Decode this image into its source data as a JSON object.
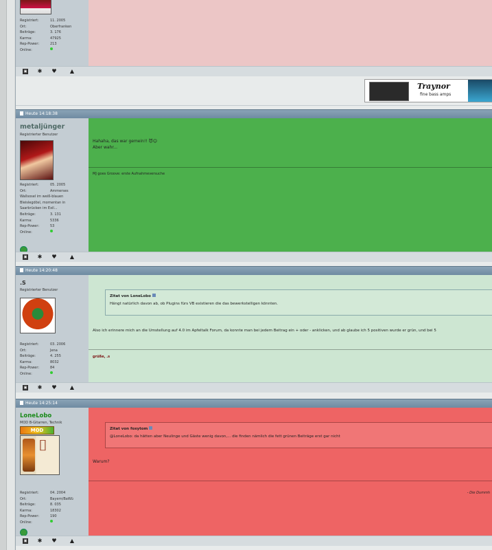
{
  "posts": [
    {
      "stats": [
        [
          "Registriert:",
          "11. 2005"
        ],
        [
          "Ort:",
          "Oberfranken"
        ],
        [
          "Beiträge:",
          "3. 176"
        ],
        [
          "Karma:",
          "47925"
        ],
        [
          "Rep-Power:",
          "213"
        ],
        [
          "Online:",
          ""
        ]
      ]
    },
    {
      "date": "Heute 14:18:38",
      "username": "metaljünger",
      "user_title": "Registrierter Benutzer",
      "stats_reg": [
        "Registriert:",
        "05. 2005"
      ],
      "stats_ort": [
        "Ort:",
        "Ammerses"
      ],
      "ort_lines": [
        "Wallsosel im weiß-blauen",
        "Bleislegdösl, momentan in",
        "Saarbrücken im Exil..."
      ],
      "stats": [
        [
          "Beiträge:",
          "3. 131"
        ],
        [
          "Karma:",
          "5336"
        ],
        [
          "Rep-Power:",
          "53"
        ],
        [
          "Online:",
          ""
        ]
      ],
      "message": [
        "Hahaha, das war gemein!! 😈😊",
        "Aber wahr..."
      ],
      "signature": "MJ goes Groove: erste Aufnahmeversuche"
    },
    {
      "date": "Heute 14:20:48",
      "username": ".S",
      "user_title": "Registrierter Benutzer",
      "stats": [
        [
          "Registriert:",
          "03. 2006"
        ],
        [
          "Ort:",
          "Jena"
        ],
        [
          "Beiträge:",
          "4. 255"
        ],
        [
          "Karma:",
          "8032"
        ],
        [
          "Rep-Power:",
          "84"
        ],
        [
          "Online:",
          ""
        ]
      ],
      "quote_from": "Zitat von LoneLobo",
      "quote_text": "Hängt natürlich davon ab, ob Plugins fürs VB existieren die das bewerkstelligen könnten.",
      "message": [
        "Also ich erinnere mich an die Umstellung auf 4.0 im Apfeltalk Forum, da konnte man bei jedem Beitrag ein + oder - anklicken, und ab glaube ich 5 positiven wurde er grün, und bei 5"
      ],
      "signature": "grüße, .s"
    },
    {
      "date": "Heute 14:25:14",
      "username": "LoneLobo",
      "user_title": "MOD B-Gitarren, Technik",
      "badge": "MOD",
      "stats": [
        [
          "Registriert:",
          "04. 2004"
        ],
        [
          "Ort:",
          "Bayern/BaWü"
        ],
        [
          "Beiträge:",
          "8. 035"
        ],
        [
          "Karma:",
          "18302"
        ],
        [
          "Rep-Power:",
          "190"
        ],
        [
          "Online:",
          ""
        ]
      ],
      "quote_from": "Zitat von foxytom",
      "quote_text": "@LoneLobo: da hätten aber Neulinge und Gäste wenig davon,... die finden nämlich die fett grünen Beiträge erst gar nicht",
      "message": [
        "Warum?"
      ],
      "signature": "- Die Dummh"
    }
  ],
  "ad": {
    "brand": "Traynor",
    "tagline": "fine bass amps"
  },
  "colors": {
    "red_post": "#ecc6c6",
    "green_post": "#4cb04c",
    "lightgreen_post": "#cde6d2",
    "salmon_post": "#ee6464"
  }
}
